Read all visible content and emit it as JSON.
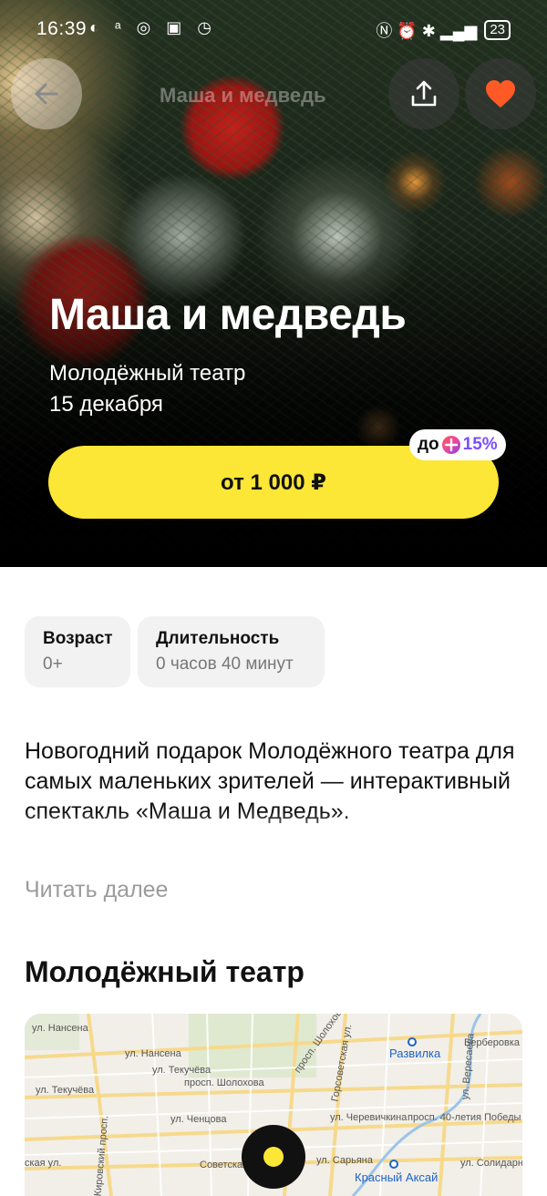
{
  "status_bar": {
    "time": "16:39",
    "left_icons": "◐ ᵃ ◎ ▣ ◷",
    "right_icons": "Ⓝ ⏰ ✱ ▂▄▆",
    "battery": "23"
  },
  "header": {
    "title": "Маша и медведь",
    "back_icon": "arrow-left-icon",
    "share_icon": "share-icon",
    "favorite_icon": "heart-icon"
  },
  "event": {
    "title": "Маша и медведь",
    "venue": "Молодёжный театр",
    "date": "15 декабря",
    "buy_label": "от 1 000 ₽",
    "plus_prefix": "до",
    "plus_percent": "15%"
  },
  "info": {
    "age_label": "Возраст",
    "age_value": "0+",
    "duration_label": "Длительность",
    "duration_value": "0 часов 40 минут"
  },
  "description": {
    "text": "Новогодний подарок Молодёжного театра для самых маленьких зрителей — интерактивный спектакль «Маша и Медведь».",
    "read_more": "Читать далее"
  },
  "venue_section": {
    "title": "Молодёжный театр"
  },
  "map": {
    "labels": {
      "nansena": "ул. Нансена",
      "nansena2": "ул. Нансена",
      "tekucheva": "ул. Текучёва",
      "tekucheva2": "ул. Текучёва",
      "sholokhova": "просп. Шолохова",
      "sholokhova2": "просп. Шолохова",
      "gorsovetskaya": "Горсоветская ул.",
      "razvilka": "Развилка",
      "berberovka": "Берберовка",
      "veresaeva": "ул. Вересаева",
      "chentsova": "ул. Ченцова",
      "cherevichkina": "ул. Черевичкина",
      "pobedy": "просп. 40-летия Победы",
      "kirovsky": "Кировский просп.",
      "sovetskaya": "Советская",
      "saryana": "ул. Сарьяна",
      "aksay": "Красный Аксай",
      "solidarnosti": "ул. Солидарно",
      "skaya": "ская ул."
    }
  }
}
